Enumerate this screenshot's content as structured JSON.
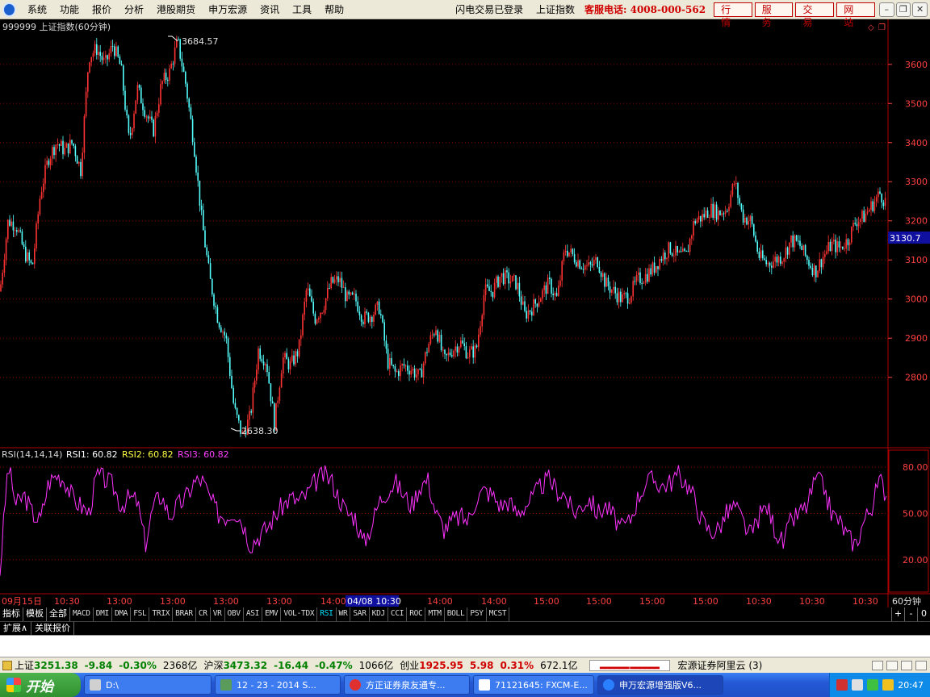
{
  "menu": {
    "items": [
      "系统",
      "功能",
      "报价",
      "分析",
      "港股期货",
      "申万宏源",
      "资讯",
      "工具",
      "帮助"
    ],
    "status": [
      "闪电交易已登录",
      "上证指数"
    ],
    "hotline": "客服电话: 4008-000-562",
    "quick_buttons": [
      "行情",
      "服务",
      "交易",
      "网站"
    ]
  },
  "chart": {
    "title": "999999 上证指数(60分钟)",
    "high_label": "3684.57",
    "low_label": "2638.30",
    "current_price": "3130.7",
    "period": "60分钟"
  },
  "indicator": {
    "params": "RSI(14,14,14)",
    "rsi1": "RSI1: 60.82",
    "rsi2": "RSI2: 60.82",
    "rsi3": "RSI3: 60.82"
  },
  "colors": {
    "up": "#ff3333",
    "down": "#54ffff",
    "rsi": "#ff33ff",
    "grid": "#8b0000",
    "axis_text": "#ff4040"
  },
  "chart_data": [
    {
      "type": "candlestick",
      "title": "999999 上证指数(60分钟)",
      "y_ticks": [
        2800,
        2900,
        3000,
        3100,
        3200,
        3300,
        3400,
        3500,
        3600
      ],
      "ylim": [
        2620,
        3715
      ],
      "x_tick_labels": [
        "09月15日",
        "10:30",
        "13:00",
        "13:00",
        "13:00",
        "13:00",
        "14:00",
        "04/08 10:30",
        "14:00",
        "14:00",
        "15:00",
        "15:00",
        "15:00",
        "15:00",
        "10:30",
        "10:30",
        "10:30"
      ],
      "close_path_x": [
        0,
        10,
        20,
        30,
        40,
        50,
        60,
        70,
        80,
        90,
        100,
        110,
        120,
        130,
        140,
        150,
        160,
        170,
        180,
        190,
        200,
        210,
        220,
        230,
        240,
        250,
        260,
        270,
        280,
        290,
        300,
        310,
        320,
        330,
        340,
        350,
        360,
        370,
        380,
        390,
        400,
        410,
        420,
        430,
        440,
        450,
        460,
        470,
        480,
        490,
        500,
        510,
        520,
        530,
        540,
        550,
        560,
        570,
        580,
        590,
        600,
        610,
        620,
        630,
        640,
        650,
        660,
        670,
        680,
        690,
        700,
        710,
        720,
        730,
        740,
        750,
        760,
        770,
        780,
        790,
        800,
        810,
        820,
        830,
        840,
        850,
        860,
        870,
        880,
        890,
        900,
        910,
        920,
        930,
        940,
        950,
        960,
        970,
        980,
        990,
        1000,
        1010,
        1020,
        1030,
        1040,
        1050,
        1060,
        1070,
        1080,
        1090,
        1100
      ],
      "close_path_y": [
        3020,
        3200,
        3190,
        3120,
        3080,
        3270,
        3360,
        3400,
        3380,
        3400,
        3330,
        3620,
        3640,
        3600,
        3650,
        3590,
        3400,
        3540,
        3480,
        3430,
        3550,
        3580,
        3660,
        3550,
        3400,
        3200,
        3050,
        2950,
        2900,
        2720,
        2650,
        2700,
        2870,
        2840,
        2680,
        2850,
        2830,
        2870,
        3030,
        2950,
        2980,
        3040,
        3050,
        3000,
        3000,
        2950,
        2960,
        2980,
        2840,
        2810,
        2830,
        2820,
        2800,
        2880,
        2930,
        2840,
        2870,
        2890,
        2860,
        2870,
        3020,
        3020,
        3060,
        3050,
        3040,
        2960,
        2980,
        3010,
        3040,
        3000,
        3130,
        3110,
        3090,
        3080,
        3100,
        3040,
        3020,
        3000,
        3010,
        3050,
        3060,
        3080,
        3110,
        3130,
        3110,
        3110,
        3200,
        3210,
        3230,
        3220,
        3230,
        3300,
        3210,
        3200,
        3110,
        3090,
        3100,
        3110,
        3150,
        3140,
        3100,
        3070,
        3110,
        3140,
        3130,
        3150,
        3200,
        3210,
        3240,
        3270,
        3240
      ]
    },
    {
      "type": "line",
      "title": "RSI(14,14,14)",
      "y_ticks": [
        20,
        50,
        80
      ],
      "ylim": [
        0,
        90
      ],
      "series": [
        {
          "name": "RSI1",
          "values": [
            12,
            82,
            55,
            62,
            50,
            45,
            70,
            75,
            72,
            60,
            55,
            50,
            75,
            72,
            68,
            55,
            60,
            58,
            30,
            55,
            62,
            48,
            55,
            60,
            70,
            72,
            60,
            50,
            48,
            52,
            45,
            30,
            35,
            40,
            48,
            55,
            60,
            58,
            62,
            70,
            75,
            72,
            60,
            50,
            48,
            30,
            42,
            58,
            65,
            70,
            62,
            55,
            68,
            72,
            50,
            40,
            45,
            48,
            45,
            60,
            65,
            62,
            55,
            58,
            50,
            55,
            60,
            68,
            72,
            65,
            62,
            50,
            55,
            60,
            50,
            55,
            48,
            40,
            45,
            60,
            70,
            72,
            68,
            70,
            75,
            70,
            60,
            45,
            38,
            40,
            50,
            55,
            45,
            35,
            48,
            55,
            40,
            30,
            45,
            50,
            55,
            72,
            68,
            50,
            45,
            35,
            30,
            45,
            55,
            72,
            60
          ]
        }
      ]
    }
  ],
  "indicator_tabs": {
    "left": [
      "指标",
      "模板",
      "全部"
    ],
    "tabs": [
      "MACD",
      "DMI",
      "DMA",
      "FSL",
      "TRIX",
      "BRAR",
      "CR",
      "VR",
      "OBV",
      "ASI",
      "EMV",
      "VOL-TDX",
      "RSI",
      "WR",
      "SAR",
      "KDJ",
      "CCI",
      "ROC",
      "MTM",
      "BOLL",
      "PSY",
      "MCST"
    ],
    "active": "RSI",
    "controls": [
      "+",
      "-",
      "0"
    ]
  },
  "ext_tabs": [
    "扩展∧",
    "关联报价"
  ],
  "ticker": {
    "sh_label": "上证",
    "sh_price": "3251.38",
    "sh_change": "-9.84",
    "sh_pct": "-0.30%",
    "sh_amount": "2368亿",
    "hs_label": "沪深",
    "hs_price": "3473.32",
    "hs_change": "-16.44",
    "hs_pct": "-0.47%",
    "hs_amount": "1066亿",
    "cy_label": "创业",
    "cy_price": "1925.95",
    "cy_change": "5.98",
    "cy_pct": "0.31%",
    "cy_amount": "672.1亿",
    "mini": "▂▂▂▂▂▂ ▂▂▂▂▂▂",
    "broker": "宏源证券阿里云 (3)"
  },
  "taskbar": {
    "start": "开始",
    "tasks": [
      "D:\\",
      "12 - 23 - 2014 S...",
      "方正证券泉友通专...",
      "71121645: FXCM-E...",
      "申万宏源增强版V6..."
    ],
    "time": "20:47"
  }
}
